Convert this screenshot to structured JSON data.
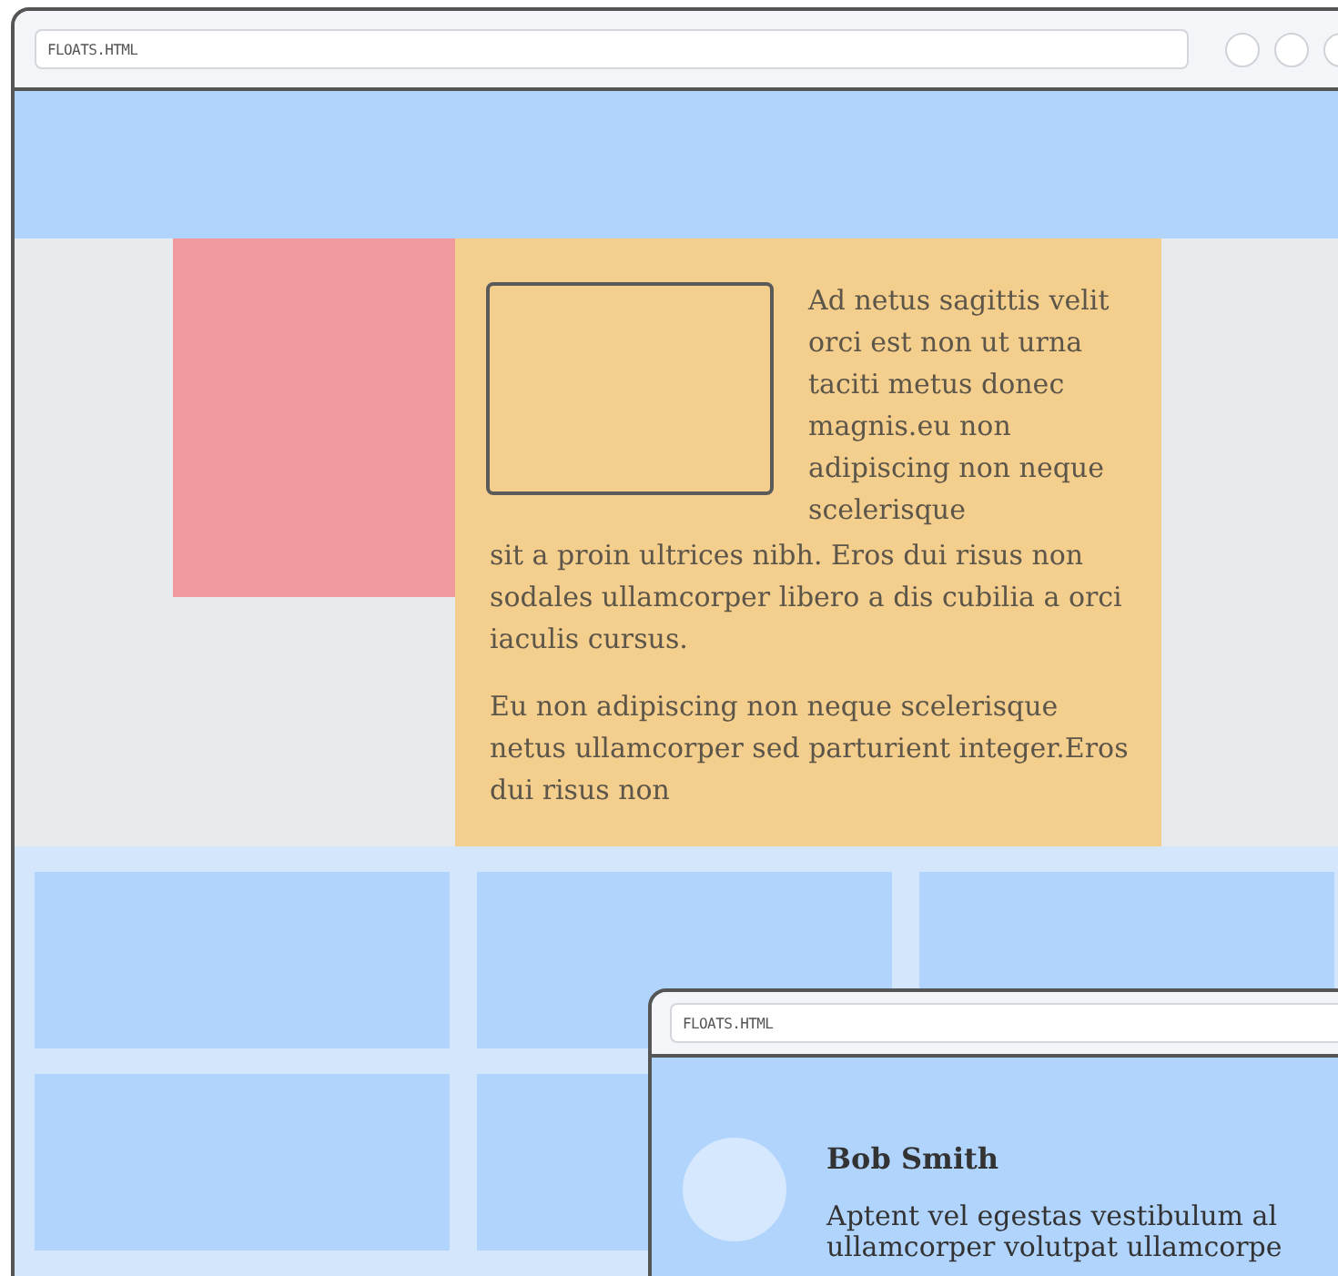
{
  "window": {
    "url": "FLOATS.HTML"
  },
  "article": {
    "side_text": "Ad netus sagittis velit orci est non ut urna taciti metus donec magnis.eu non adipiscing non neque scelerisque",
    "paragraphs": [
      "sit a proin ultrices nibh. Eros dui risus non sodales ullamcorper libero a dis cubilia a orci iaculis cursus.",
      "Eu non adipiscing non neque scelerisque netus ullamcorper sed parturient integer.Eros dui risus non"
    ]
  },
  "popup": {
    "url": "FLOATS.HTML",
    "name": "Bob Smith",
    "bio_lines": [
      "Aptent vel egestas vestibulum al",
      "ullamcorper volutpat ullamcorpe"
    ]
  }
}
